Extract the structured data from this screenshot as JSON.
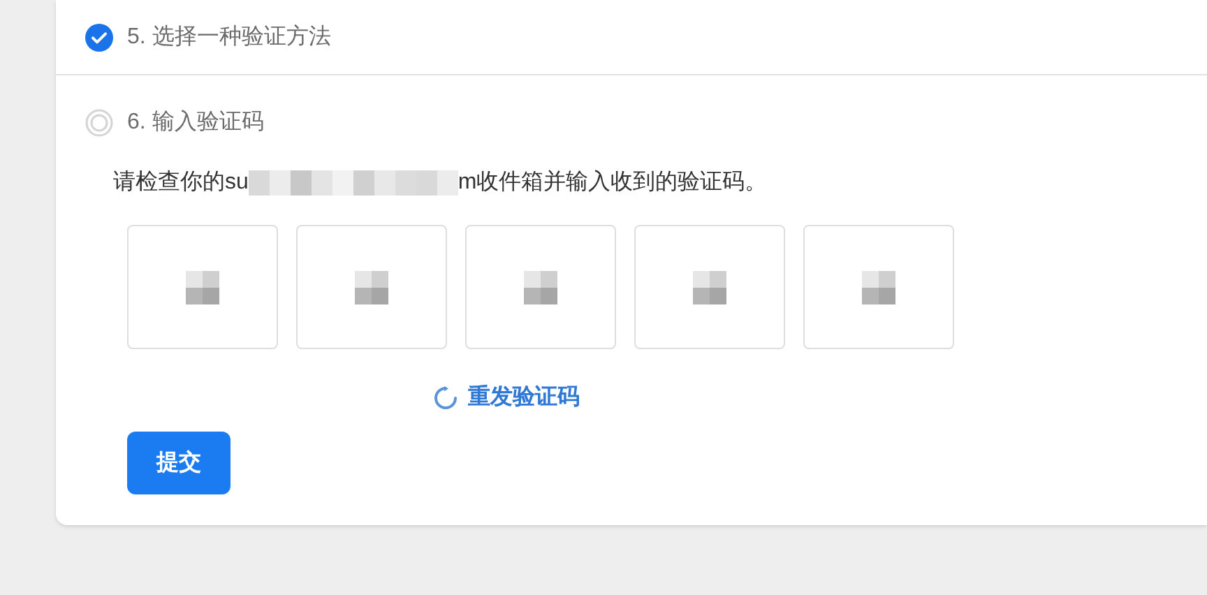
{
  "steps": [
    {
      "label": "5. 选择一种验证方法",
      "checked": true
    },
    {
      "label": "6. 输入验证码",
      "checked": false
    }
  ],
  "instruction": {
    "before": "请检查你的su",
    "redacted": true,
    "after": "m收件箱并输入收到的验证码。"
  },
  "code_boxes": [
    {
      "redacted": true
    },
    {
      "redacted": true
    },
    {
      "redacted": true
    },
    {
      "redacted": true
    },
    {
      "redacted": true
    }
  ],
  "resend_link": "重发验证码",
  "submit_button": "提交"
}
